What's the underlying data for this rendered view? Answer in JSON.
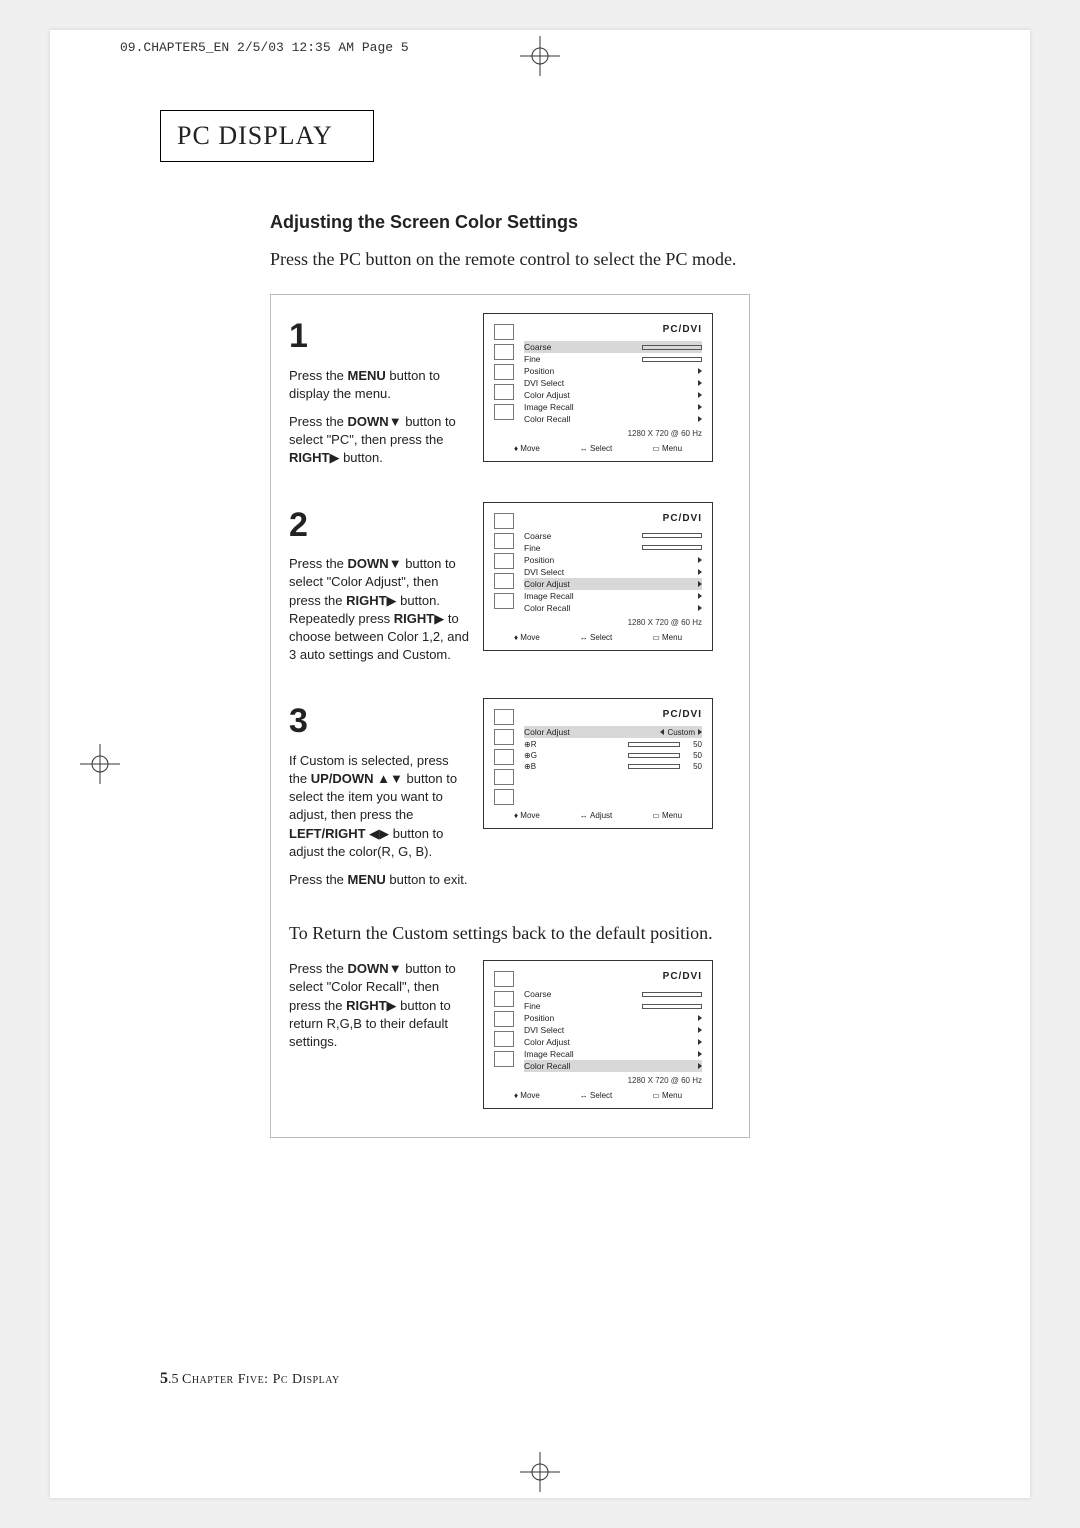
{
  "print_header": "09.CHAPTER5_EN  2/5/03 12:35 AM  Page 5",
  "chapter_title_a": "P",
  "chapter_title_b": "C",
  "chapter_title_c": " D",
  "chapter_title_d": "ISPLAY",
  "section_title": "Adjusting the Screen Color Settings",
  "intro": "Press the PC button on the remote control to select the PC mode.",
  "step1": {
    "num": "1",
    "p1a": "Press the ",
    "p1b": "MENU",
    "p1c": " button to display the menu.",
    "p2a": "Press the ",
    "p2b": "DOWN",
    "p2arrow": "▼",
    "p2c": " button to select \"PC\", then press the ",
    "p2d": "RIGHT",
    "p2arrow2": "▶",
    "p2e": " button."
  },
  "step2": {
    "num": "2",
    "pa": "Press the ",
    "pb": "DOWN",
    "parrow": "▼",
    "pc": " button to select \"Color Adjust\", then press the ",
    "pd": "RIGHT",
    "parrow2": "▶",
    "pe": " button. Repeatedly press ",
    "pf": "RIGHT",
    "parrow3": "▶",
    "pg": " to choose between Color 1,2, and 3 auto settings and Custom."
  },
  "step3": {
    "num": "3",
    "pa": "If Custom is selected, press the ",
    "pb": "UP/DOWN",
    "arrow_ud": "▲▼",
    "pc": " button to select the item you want to adjust, then press the ",
    "pd": "LEFT/RIGHT",
    "arrow_lr": "◀▶",
    "pe": " button to adjust  the color(R, G, B).",
    "exit_a": "Press the ",
    "exit_b": "MENU",
    "exit_c": " button to exit."
  },
  "return_text": "To Return the Custom settings back to the default position.",
  "step4": {
    "pa": "Press the ",
    "pb": "DOWN",
    "arrow": "▼",
    "pc": " button to select \"Color Recall\", then press the ",
    "pd": "RIGHT",
    "arrow2": "▶",
    "pe": " button to return R,G,B to their default settings."
  },
  "osd": {
    "title": "PC/DVI",
    "items": [
      "Coarse",
      "Fine",
      "Position",
      "DVI Select",
      "Color Adjust",
      "Image Recall",
      "Color Recall"
    ],
    "res": "1280 X 720 @ 60 Hz",
    "footer_move": "Move",
    "footer_select": "Select",
    "footer_adjust": "Adjust",
    "footer_menu": "Menu",
    "custom": "Custom",
    "color_adjust": "Color Adjust",
    "rgb": [
      {
        "lbl": "R",
        "val": "50"
      },
      {
        "lbl": "G",
        "val": "50"
      },
      {
        "lbl": "B",
        "val": "50"
      }
    ]
  },
  "footer": {
    "page": "5",
    "dot": ".",
    "sub": "5",
    "chapter": " Chapter Five: Pc Display"
  }
}
